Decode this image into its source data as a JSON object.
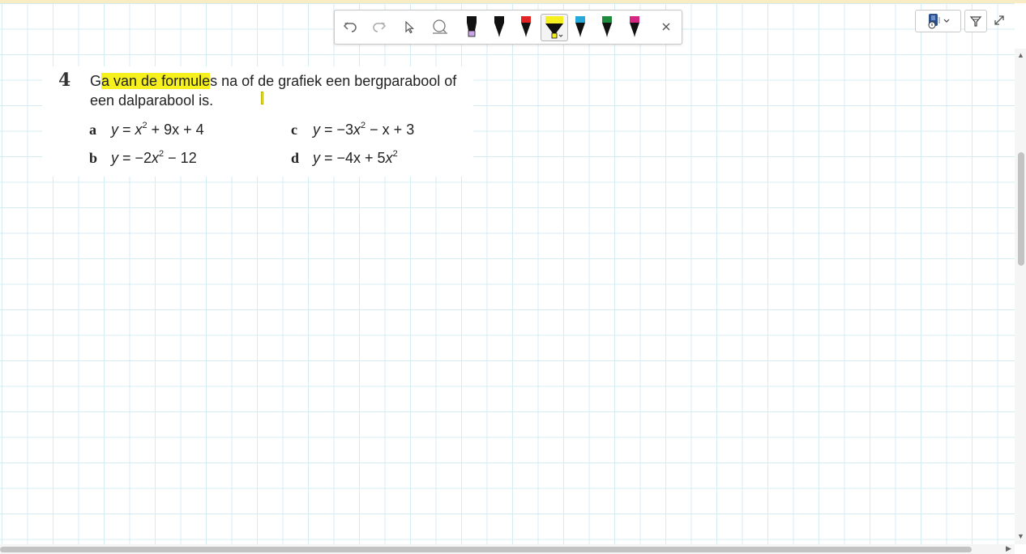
{
  "toolbar": {
    "tools": [
      "undo-icon",
      "redo-icon",
      "select-pointer-icon",
      "lasso-eraser-icon"
    ],
    "pens": [
      {
        "name": "pen-purple-highlighter",
        "cap": "#111111",
        "tip": "#c9a5e8"
      },
      {
        "name": "pen-black",
        "cap": "#111111",
        "tip": "#111111"
      },
      {
        "name": "pen-red",
        "cap": "#e02424",
        "tip": "#111111"
      },
      {
        "name": "pen-yellow-highlighter",
        "cap": "#f6f11e",
        "tip": "#f6f11e",
        "active": true
      },
      {
        "name": "pen-cyan",
        "cap": "#27a9d8",
        "tip": "#111111"
      },
      {
        "name": "pen-green",
        "cap": "#1d8a3c",
        "tip": "#111111"
      },
      {
        "name": "pen-magenta",
        "cap": "#d6267f",
        "tip": "#111111"
      }
    ],
    "close_icon": "close-icon"
  },
  "exercise": {
    "number": "4",
    "question_line1_pre": "G",
    "question_line1_highlight": "a van de formule",
    "question_line1_post": "s na of de grafiek een bergparabool of",
    "question_line2": "een dalparabool is.",
    "items": [
      {
        "letter": "a",
        "y": "y",
        "eq": " = ",
        "x": "x",
        "exp": "2",
        "rest": " + 9x + 4"
      },
      {
        "letter": "c",
        "y": "y",
        "eq": " = −3",
        "x": "x",
        "exp": "2",
        "rest": " − x + 3"
      },
      {
        "letter": "b",
        "y": "y",
        "eq": " = −2",
        "x": "x",
        "exp": "2",
        "rest": " − 12"
      },
      {
        "letter": "d",
        "y": "y",
        "eq": " = −4x + 5",
        "x": "x",
        "exp": "2",
        "rest": ""
      }
    ]
  },
  "colors": {
    "highlight": "#f6f11e",
    "grid": "#d6ecf3",
    "topline": "#f7ecc4"
  }
}
